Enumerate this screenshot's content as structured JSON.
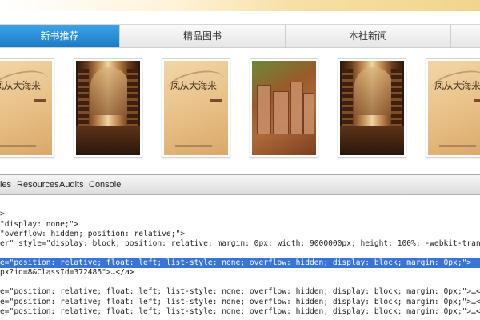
{
  "tabs": [
    {
      "label": "新书推荐",
      "active": true
    },
    {
      "label": "精品图书",
      "active": false
    },
    {
      "label": "本社新闻",
      "active": false
    },
    {
      "label": "",
      "active": false
    }
  ],
  "books": [
    {
      "type": "novel",
      "title": "凤从大海来"
    },
    {
      "type": "library"
    },
    {
      "type": "novel",
      "title": "凤从大海来"
    },
    {
      "type": "sculpture"
    },
    {
      "type": "library"
    },
    {
      "type": "novel",
      "title": "凤从大海来"
    }
  ],
  "devtools": {
    "tabs": [
      "les",
      "Resources",
      "Audits",
      "Console"
    ],
    "lines": [
      ">",
      "\"display: none;\">",
      "\"overflow: hidden; position: relative;\">",
      "er\" style=\"display: block; position: relative; margin: 0px; width: 9000000px; height: 100%; -webkit-tran",
      "e=\"position: relative; float: left; list-style: none; overflow: hidden; display: block; margin: 0px;\">",
      "px?id=8&ClassId=372486\">…</a>",
      "e=\"position: relative; float: left; list-style: none; overflow: hidden; display: block; margin: 0px;\">…<",
      "e=\"position: relative; float: left; list-style: none; overflow: hidden; display: block; margin: 0px;\">…<",
      "e=\"position: relative; float: left; list-style: none; overflow: hidden; display: block; margin: 0px;\">…<"
    ],
    "selected_line": 5
  },
  "colors": {
    "active_tab": "#1a7cc6",
    "selection": "#3875d7"
  }
}
